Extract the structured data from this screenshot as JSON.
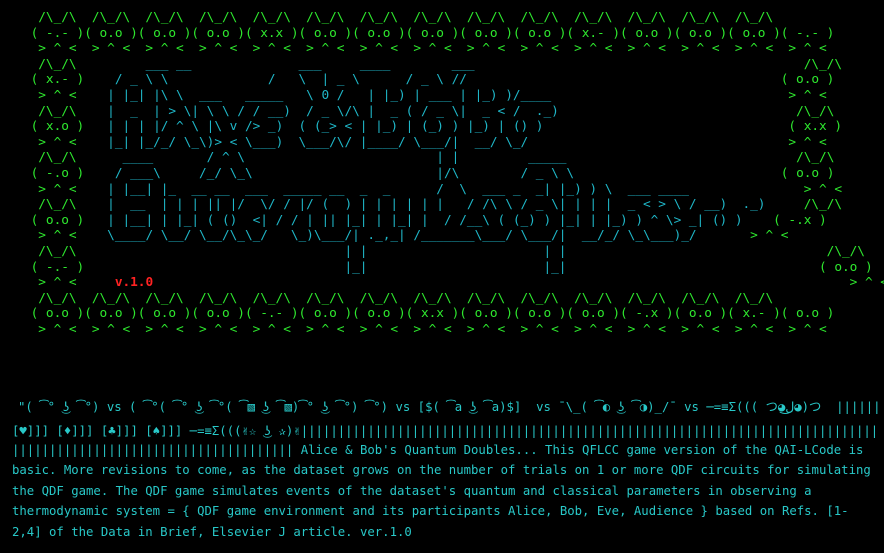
{
  "art": {
    "rows": [
      [
        {
          "t": "     /\\_/\\  /\\_/\\  /\\_/\\  /\\_/\\  /\\_/\\  /\\_/\\  /\\_/\\  /\\_/\\  /\\_/\\  /\\_/\\  /\\_/\\  /\\_/\\  /\\_/\\  /\\_/\\",
          "c": "g"
        }
      ],
      [
        {
          "t": "    ( -.- )( o.o )( o.o )( o.o )( x.x )( o.o )( o.o )( o.o )( o.o )( o.o )( x.- )( o.o )( o.o )( o.o )( -.- )",
          "c": "g"
        }
      ],
      [
        {
          "t": "     > ^ <  > ^ <  > ^ <  > ^ <  > ^ <  > ^ <  > ^ <  > ^ <  > ^ <  > ^ <  > ^ <  > ^ <  > ^ <  > ^ <  > ^ <",
          "c": "g"
        }
      ],
      [
        {
          "t": "     /\\_/\\ ",
          "c": "g"
        },
        {
          "t": "        ___ __              ___     ____        ___          ",
          "c": "c"
        },
        {
          "t": "                                 /\\_/\\",
          "c": "g"
        }
      ],
      [
        {
          "t": "    ( x.- )",
          "c": "g"
        },
        {
          "t": "    / _ \\ \\             /   \\  | _ \\      / _ \\ //         ",
          "c": "c"
        },
        {
          "t": "                                ( o.o )",
          "c": "g"
        }
      ],
      [
        {
          "t": "     > ^ < ",
          "c": "g"
        },
        {
          "t": "   | |_| |\\ \\  ___   _____   \\ 0 /   | |_) | ___ | |_) )/____ ",
          "c": "c"
        },
        {
          "t": "                              > ^ <",
          "c": "g"
        }
      ],
      [
        {
          "t": "     /\\_/\\ ",
          "c": "g"
        },
        {
          "t": "   |  _  | > \\| \\ \\ / / __)  / _ \\/\\ |  _ ( / _ \\|  _ < /  ._)",
          "c": "c"
        },
        {
          "t": "                               /\\_/\\",
          "c": "g"
        }
      ],
      [
        {
          "t": "    ( x.o )",
          "c": "g"
        },
        {
          "t": "   | | | |/ ^ \\ |\\ v /> _)  ( (_> < | |_) | (_) ) |_) | () )  ",
          "c": "c"
        },
        {
          "t": "                              ( x.x )",
          "c": "g"
        }
      ],
      [
        {
          "t": "     > ^ < ",
          "c": "g"
        },
        {
          "t": "   |_| |_/_/ \\_\\)> < \\___)  \\___/\\/ |____/ \\___/|  __/ \\_/   ",
          "c": "c"
        },
        {
          "t": "                               > ^ <",
          "c": "g"
        }
      ],
      [
        {
          "t": "     /\\_/\\ ",
          "c": "g"
        },
        {
          "t": "     ____       / ^ \\                         | |         _____  ",
          "c": "c"
        },
        {
          "t": "                            /\\_/\\",
          "c": "g"
        }
      ],
      [
        {
          "t": "    ( -.o )",
          "c": "g"
        },
        {
          "t": "    / ___\\     /_/ \\_\\                        |/\\        / _ \\ \\ ",
          "c": "c"
        },
        {
          "t": "                          ( o.o )",
          "c": "g"
        }
      ],
      [
        {
          "t": "     > ^ < ",
          "c": "g"
        },
        {
          "t": "   | |__| |_  __ __  ___  _____ __  _  _      /  \\  ___ _  _| |_) ) \\  ___ ____",
          "c": "c"
        },
        {
          "t": "               > ^ <",
          "c": "g"
        }
      ],
      [
        {
          "t": "     /\\_/\\ ",
          "c": "g"
        },
        {
          "t": "   |  __  | | | || |/  \\/ / |/ (  ) | | | | | |   / /\\ \\ / _ \\| | | |  _ < > \\ / __)  ._)",
          "c": "c"
        },
        {
          "t": "     /\\_/\\",
          "c": "g"
        }
      ],
      [
        {
          "t": "    ( o.o )",
          "c": "g"
        },
        {
          "t": "   | |__| | |_| ( ()  <| / / | || |_| | |_| |  / /__\\ ( (_) ) |_| | |_) ) ^ \\> _| () )",
          "c": "c"
        },
        {
          "t": "    ( -.x )",
          "c": "g"
        }
      ],
      [
        {
          "t": "     > ^ < ",
          "c": "g"
        },
        {
          "t": "   \\____/ \\__/ \\__/\\_\\_/   \\_)\\___/| ._,_| /_______\\___/ \\___/|  __/_/ \\_\\___)_/",
          "c": "c"
        },
        {
          "t": "       > ^ <",
          "c": "g"
        }
      ],
      [
        {
          "t": "     /\\_/\\ ",
          "c": "g"
        },
        {
          "t": "                                  | |                       | |",
          "c": "c"
        },
        {
          "t": "                                  /\\_/\\",
          "c": "g"
        }
      ],
      [
        {
          "t": "    ( -.- )",
          "c": "g"
        },
        {
          "t": "                                  |_|                       |_|",
          "c": "c"
        },
        {
          "t": "                                 ( o.o )",
          "c": "g"
        }
      ],
      [
        {
          "t": "     > ^ < ",
          "c": "g"
        },
        {
          "t": "    v.1.0",
          "c": "r"
        },
        {
          "t": "                                                                                           > ^ <",
          "c": "g"
        }
      ],
      [
        {
          "t": "     /\\_/\\  /\\_/\\  /\\_/\\  /\\_/\\  /\\_/\\  /\\_/\\  /\\_/\\  /\\_/\\  /\\_/\\  /\\_/\\  /\\_/\\  /\\_/\\  /\\_/\\  /\\_/\\",
          "c": "g"
        }
      ],
      [
        {
          "t": "    ( o.o )( o.o )( o.o )( o.o )( -.- )( o.o )( o.o )( x.x )( o.o )( o.o )( o.o )( -.x )( o.o )( x.- )( o.o )",
          "c": "g"
        }
      ],
      [
        {
          "t": "     > ^ <  > ^ <  > ^ <  > ^ <  > ^ <  > ^ <  > ^ <  > ^ <  > ^ <  > ^ <  > ^ <  > ^ <  > ^ <  > ^ <  > ^ <",
          "c": "g"
        }
      ]
    ]
  },
  "emote_line": "\"( ͡° ͜ʖ ͡°) vs ( ͡°( ͡° ͜ʖ ͡°( ͡▧ ͜ʖ ͡▧)͡° ͜ʖ ͡°) ͡°) vs [$( ͡a ͜ʖ ͡a)$]  vs ¯\\_( ͡◐ ͜ʖ ͡◑)_/¯ vs ─=≡Σ((( つ◕ل͜◕)つ  ||||||||||||||",
  "suits_line": "[♥]]] [♦]]] [♣]]] [♠]]] ─=≡Σ(((✌☆ ͜ʖ ✰)✌|||||||||||||||||||||||||||||||||||||||||||||||||||||||||||||||||||||||||||||||||||",
  "description": "|||||||||||||||||||||||||||||||||||||| Alice & Bob's Quantum Doubles... This QFLCC game version of the QAI-LCode is basic. More revisions to come, as the dataset grows on the number of trials on 1 or more QDF circuits for simulating the QDF game. The QDF game simulates events of the dataset's quantum and classical parameters in observing a thermodynamic system = { QDF game environment and its participants Alice, Bob, Eve, Audience } based on Refs. [1-2,4] of the Data in Brief, Elsevier J article. ver.1.0",
  "colors": {
    "border_green": "#2ee82e",
    "title_cyan": "#1fb7c8",
    "version_red": "#ff2222",
    "text_teal": "#28c8c8",
    "background": "#000000"
  }
}
